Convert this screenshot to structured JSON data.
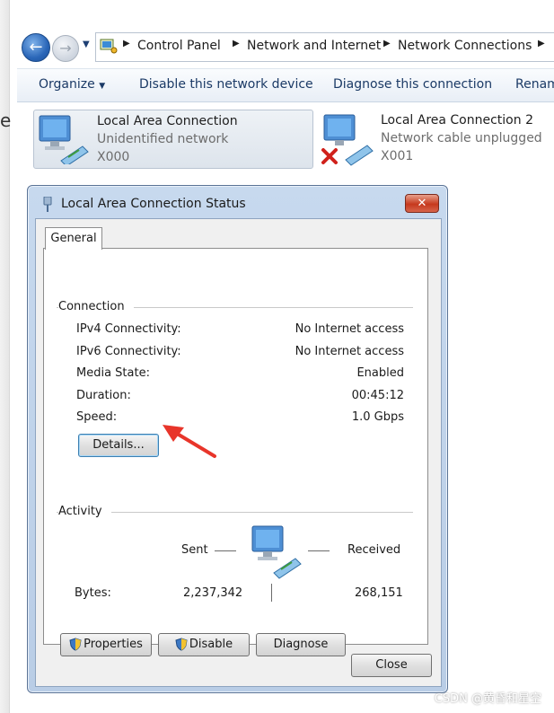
{
  "left_edge_glyph": "e",
  "navigation": {
    "back_icon": "back-arrow-icon",
    "forward_icon": "forward-arrow-icon",
    "history_icon": "chevron-down-icon",
    "breadcrumbs": [
      "Control Panel",
      "Network and Internet",
      "Network Connections"
    ],
    "separator": "▶"
  },
  "command_bar": {
    "organize": "Organize",
    "disable": "Disable this network device",
    "diagnose": "Diagnose this connection",
    "rename": "Renam"
  },
  "connections": [
    {
      "name": "Local Area Connection",
      "status": "Unidentified network",
      "device": "X000"
    },
    {
      "name": "Local Area Connection 2",
      "status": "Network cable unplugged",
      "device": "X001"
    }
  ],
  "dialog": {
    "title": "Local Area Connection Status",
    "close_icon": "close-icon",
    "tab": "General",
    "connection_group": "Connection",
    "rows": [
      {
        "label": "IPv4 Connectivity:",
        "value": "No Internet access"
      },
      {
        "label": "IPv6 Connectivity:",
        "value": "No Internet access"
      },
      {
        "label": "Media State:",
        "value": "Enabled"
      },
      {
        "label": "Duration:",
        "value": "00:45:12"
      },
      {
        "label": "Speed:",
        "value": "1.0 Gbps"
      }
    ],
    "details_button": "Details...",
    "activity_group": "Activity",
    "sent_label": "Sent",
    "received_label": "Received",
    "bytes_label": "Bytes:",
    "bytes_sent": "2,237,342",
    "bytes_received": "268,151",
    "properties_button": "Properties",
    "disable_button": "Disable",
    "diagnose_button": "Diagnose",
    "close_button": "Close"
  },
  "watermark": "CSDN @黄昏和星空",
  "colors": {
    "arrow": "#e8352a",
    "title_bar": "#c3d6ec",
    "link_text": "#1b3a66"
  }
}
